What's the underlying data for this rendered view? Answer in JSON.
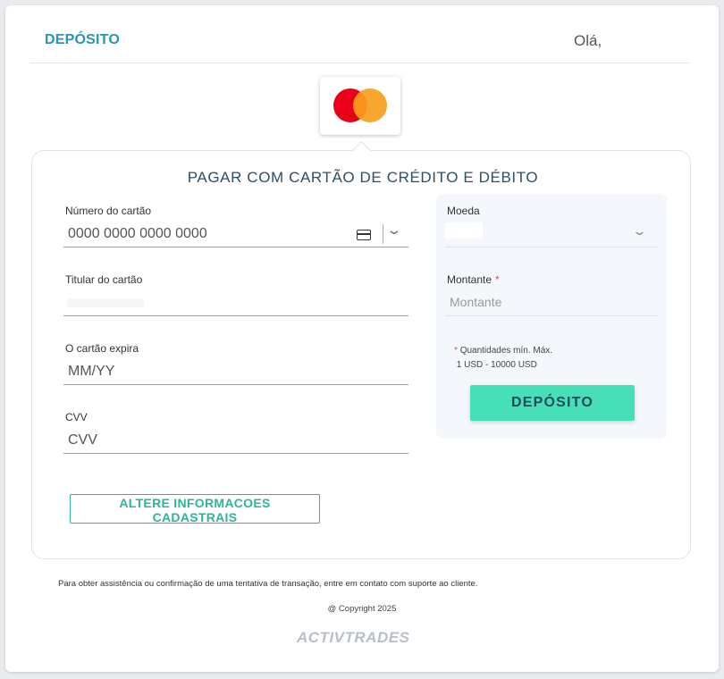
{
  "header": {
    "title": "DEPÓSITO",
    "greeting": "Olá,"
  },
  "card_brand": "mastercard",
  "form": {
    "title": "PAGAR COM CARTÃO DE CRÉDITO E DÉBITO",
    "card_number": {
      "label": "Número do cartão",
      "placeholder": "0000 0000 0000 0000"
    },
    "card_holder": {
      "label": "Titular do cartão"
    },
    "expiry": {
      "label": "O cartão expira",
      "placeholder": "MM/YY"
    },
    "cvv": {
      "label": "CVV",
      "placeholder": "CVV"
    },
    "change_info_button": "ALTERE INFORMACOES CADASTRAIS"
  },
  "side": {
    "currency": {
      "label": "Moeda"
    },
    "amount": {
      "label": "Montante",
      "required_mark": "*",
      "placeholder": "Montante"
    },
    "note": {
      "star": "*",
      "line1": "Quantidades mín. Máx.",
      "line2": "1 USD - 10000 USD"
    },
    "deposit_button": "DEPÓSITO"
  },
  "footer": {
    "note": "Para obter assistência ou confirmação de uma tentativa de transação, entre em contato com suporte ao cliente.",
    "copyright": "@ Copyright 2025",
    "brand": "ACTIVTRADES"
  },
  "colors": {
    "accent": "#2a93b8",
    "button": "#46dfb8",
    "outline_button": "#2bb59a"
  }
}
